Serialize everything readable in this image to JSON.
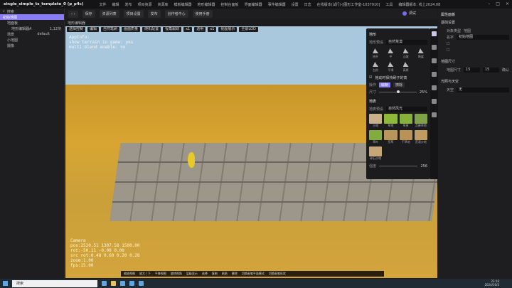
{
  "app": {
    "title": "single_simple_ts_template_0 (p_p4c)",
    "menus": [
      "文件",
      "编辑",
      "发布",
      "项目资源",
      "资源库",
      "模板编辑器",
      "地形编辑器",
      "控制台面板",
      "界面编辑器",
      "事件编辑器",
      "设置",
      "日志",
      "在线版本(试行)-[图形工作室-1037910]",
      "工具",
      "编辑器版本: 线上2024.08"
    ]
  },
  "toolbar": {
    "buttons": [
      "保存",
      "资源列表",
      "项目设置",
      "发布",
      "创作者中心",
      "使用手册"
    ],
    "play_label": "调试"
  },
  "left": {
    "search_placeholder": "搜索",
    "items": [
      {
        "label": "初始地图",
        "sel": true
      },
      {
        "label": "地面板"
      },
      {
        "label": "地形编辑器A",
        "value": "1,12块"
      },
      {
        "label": "场景",
        "value": "default"
      },
      {
        "label": "小地图"
      },
      {
        "label": "摄像"
      }
    ]
  },
  "viewport": {
    "header": "地形编辑器",
    "tools": [
      "选择控制",
      "编辑",
      "自然笔刷",
      "画面质量",
      "随机配置",
      "视角跟踪",
      "x1",
      "透明",
      "x1",
      "视图展示",
      "全景LOD"
    ],
    "info": "AppInfo:\nshow terrain in game: yes\nmulti blend enable: no",
    "camera": "Camera\npos:2520.51 1307.58 1500.00\nrot:-50.11 -0.00 0.00\nsrc rot:0.48 0.60 0.20 0.28\nzoom:1.00\nfps:15.00",
    "hotkeys": [
      "缩放视图",
      "放大 / 下",
      "平移视图",
      "旋转视角",
      "层级显示",
      "选择",
      "复制",
      "粘贴",
      "删除",
      "切换画笔平面模式",
      "切换画笔形状"
    ]
  },
  "panel": {
    "terrain_title": "地形",
    "preset_label": "地形预设",
    "preset_value": "自然荒漠",
    "shapes": [
      "抬升",
      "平",
      "山坡",
      "断崖",
      "台阶",
      "平滑",
      "高原"
    ],
    "lock_label": "拖动时保持刷子的高",
    "op_label": "操作",
    "op_a": "绘制",
    "op_b": "擦除",
    "size_label": "尺寸",
    "size_value": "25%",
    "tex_title": "地表",
    "tex_preset_label": "地表预设",
    "tex_preset_value": "自然风光",
    "textures": [
      {
        "label": "沙地",
        "color": "#c9b08a"
      },
      {
        "label": "草地",
        "color": "#8fb83a"
      },
      {
        "label": "草原",
        "color": "#86b13c"
      },
      {
        "label": "苔藓草地",
        "color": "#7fa248"
      },
      {
        "label": "草叶",
        "color": "#82ad3e"
      },
      {
        "label": "荒草",
        "color": "#b8955a"
      },
      {
        "label": "干草地",
        "color": "#b99255"
      },
      {
        "label": "荒漠沙地",
        "color": "#c19c62"
      },
      {
        "label": "碎石沙地",
        "color": "#c6a577"
      }
    ],
    "strength_label": "强度",
    "strength_value": "256"
  },
  "right": {
    "title": "属性面板",
    "sec1": "基础设置",
    "name_label": "名字",
    "name_value": "初始地图",
    "type_label": "对象类型",
    "type_value": "地图",
    "sec2": "地图尺寸",
    "size_label": "地图尺寸",
    "w": "15",
    "h": "15",
    "confirm": "确认",
    "sec3": "光照与天空",
    "sky_label": "天空",
    "sky_value": "无"
  },
  "taskbar": {
    "search": "搜索",
    "time": "23:16",
    "date": "2024/10/3"
  }
}
